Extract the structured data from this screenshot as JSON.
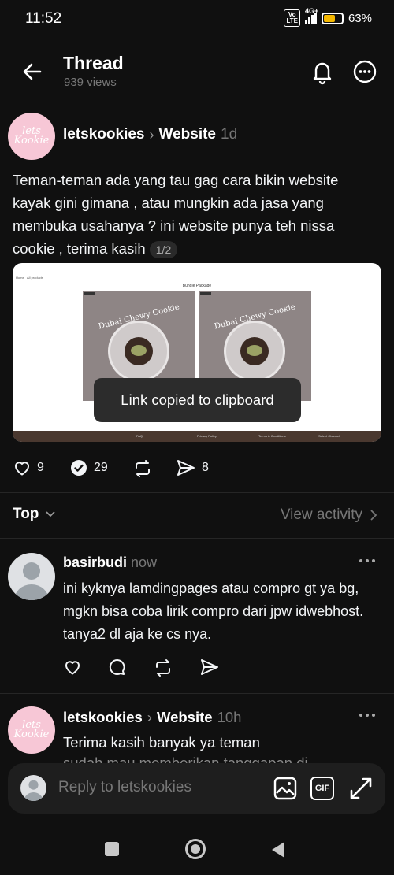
{
  "status_bar": {
    "time": "11:52",
    "network": "4G+",
    "volte_line1": "Vo",
    "volte_line2": "LTE",
    "battery_pct": "63%",
    "battery_level": 0.63,
    "battery_color": "#f5b800"
  },
  "header": {
    "title": "Thread",
    "views": "939 views"
  },
  "post": {
    "author": "letskookies",
    "topic": "Website",
    "time": "1d",
    "avatar_text_1": "lets",
    "avatar_text_2": "Kookie",
    "text": "Teman-teman ada yang tau gag cara bikin website kayak gini gimana , atau mungkin ada jasa yang membuka usahanya ? ini website punya teh nissa cookie , terima kasih",
    "media_counter": "1/2",
    "image": {
      "nav_left": "Home",
      "nav_left2": "All products",
      "section_title": "Bundle Package",
      "product_label": "Dubai Chewy Cookie",
      "footer_links": [
        "FAQ",
        "Privacy Policy",
        "Terms & Conditions",
        "Select Channel"
      ]
    },
    "likes": "9",
    "replies": "29",
    "shares": "8"
  },
  "toast": "Link copied to clipboard",
  "sort": {
    "label": "Top",
    "view_activity": "View activity"
  },
  "comments": [
    {
      "user": "basirbudi",
      "time": "now",
      "text": "ini kyknya lamdingpages atau compro gt ya bg,  mgkn bisa coba lirik compro dari jpw idwebhost. tanya2 dl aja ke cs nya."
    },
    {
      "user": "letskookies",
      "topic": "Website",
      "time": "10h",
      "text_line1": "Terima kasih banyak ya teman",
      "text_line2": "sudah mau memberikan tanggapan di"
    }
  ],
  "reply_bar": {
    "placeholder": "Reply to letskookies",
    "gif_label": "GIF"
  },
  "colors": {
    "background": "#101010",
    "avatar_pink": "#f7c7d6",
    "muted": "#777777"
  }
}
